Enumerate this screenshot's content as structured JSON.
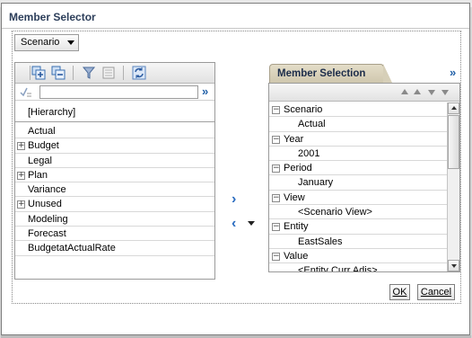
{
  "dialog": {
    "title": "Member Selector"
  },
  "dimension_select": {
    "value": "Scenario"
  },
  "left_panel": {
    "search": {
      "value": "",
      "more_glyph": "»"
    },
    "header": "[Hierarchy]",
    "rows": [
      {
        "label": "Actual",
        "expandable": false
      },
      {
        "label": "Budget",
        "expandable": true
      },
      {
        "label": "Legal",
        "expandable": false
      },
      {
        "label": "Plan",
        "expandable": true
      },
      {
        "label": "Variance",
        "expandable": false
      },
      {
        "label": "Unused",
        "expandable": true
      },
      {
        "label": "Modeling",
        "expandable": false
      },
      {
        "label": "Forecast",
        "expandable": false
      },
      {
        "label": "BudgetatActualRate",
        "expandable": false
      }
    ]
  },
  "move": {
    "right_glyph": "›",
    "left_glyph": "‹"
  },
  "selection_panel": {
    "tab_label": "Member Selection",
    "more_glyph": "»",
    "groups": [
      {
        "label": "Scenario",
        "member": "Actual"
      },
      {
        "label": "Year",
        "member": "2001"
      },
      {
        "label": "Period",
        "member": "January"
      },
      {
        "label": "View",
        "member": "<Scenario View>"
      },
      {
        "label": "Entity",
        "member": "EastSales"
      },
      {
        "label": "Value",
        "member": "<Entity Curr Adjs>"
      }
    ]
  },
  "buttons": {
    "ok": "OK",
    "cancel": "Cancel"
  },
  "colors": {
    "link_blue": "#2160a8",
    "tab_bg": "#d6cfb8",
    "title_text": "#2c3e5a"
  },
  "icons": [
    "add-member-icon",
    "remove-member-icon",
    "filter-icon",
    "properties-icon",
    "refresh-icon",
    "search-options-icon",
    "move-right-icon",
    "move-left-icon",
    "expand-icon",
    "collapse-icon"
  ]
}
